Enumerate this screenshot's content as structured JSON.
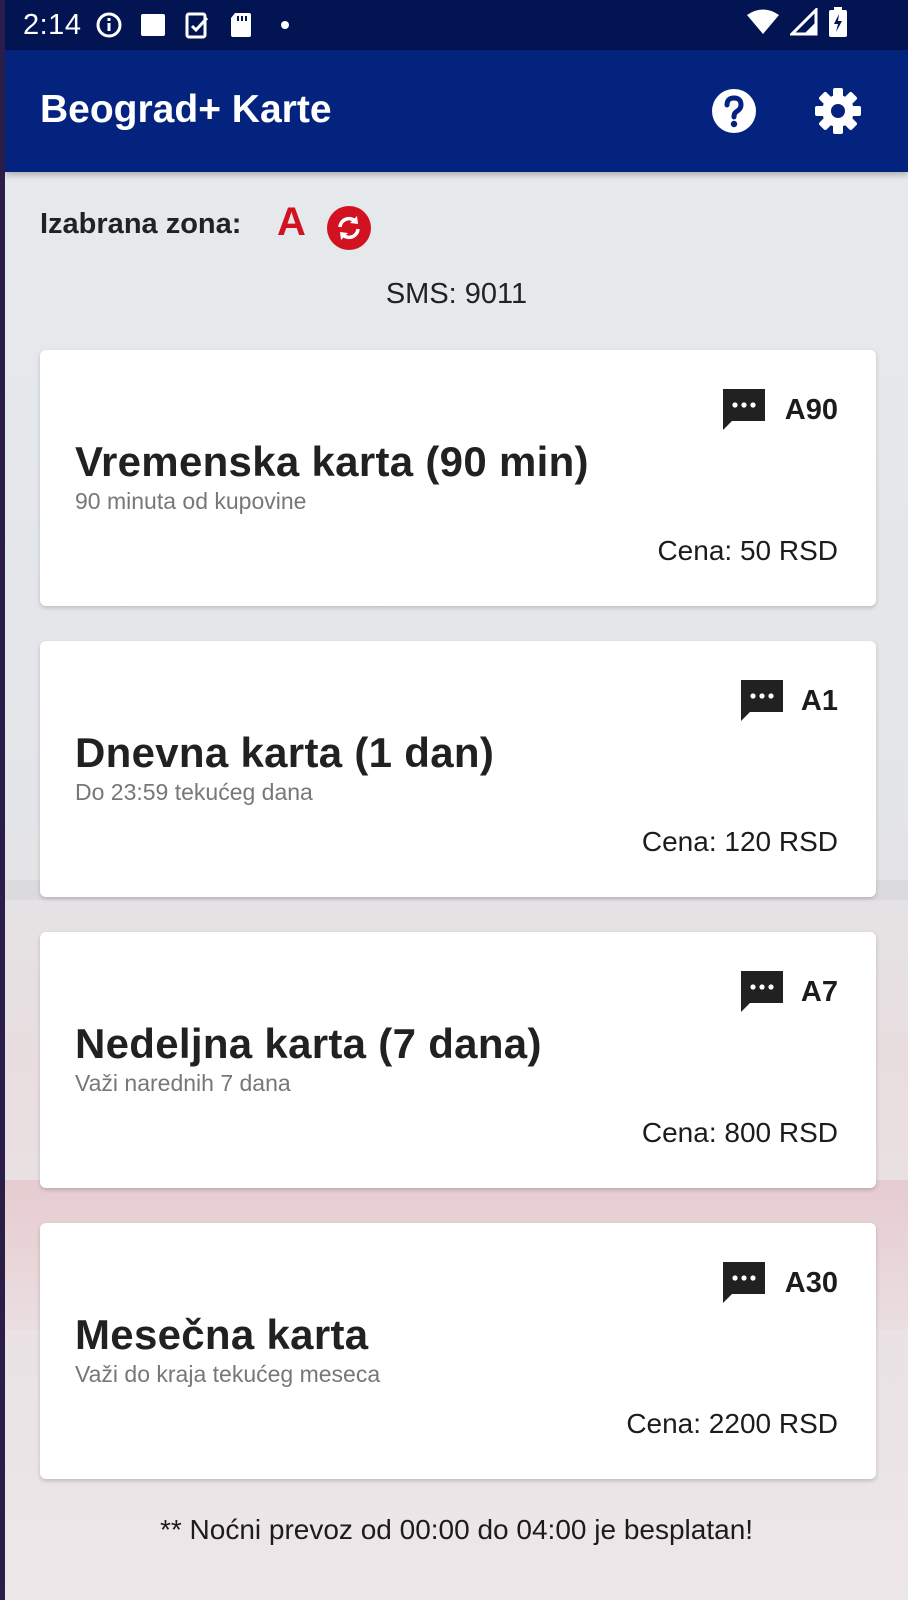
{
  "status_bar": {
    "time": "2:14",
    "left_icons": [
      "info-icon",
      "square-icon",
      "checklist-icon",
      "sd-card-icon",
      "dot-icon"
    ],
    "right_icons": [
      "wifi-icon",
      "signal-icon",
      "battery-charging-icon"
    ]
  },
  "app_bar": {
    "title": "Beograd+ Karte",
    "help_icon": "help-circle-icon",
    "settings_icon": "gear-icon"
  },
  "zone": {
    "label": "Izabrana zona:",
    "value": "A",
    "switch_icon": "sync-icon"
  },
  "sms_number": "SMS: 9011",
  "tickets": [
    {
      "code": "A90",
      "title": "Vremenska karta (90 min)",
      "subtitle": "90 minuta od kupovine",
      "price": "Cena: 50 RSD"
    },
    {
      "code": "A1",
      "title": "Dnevna karta (1 dan)",
      "subtitle": "Do 23:59 tekućeg dana",
      "price": "Cena: 120 RSD"
    },
    {
      "code": "A7",
      "title": "Nedeljna karta (7 dana)",
      "subtitle": "Važi narednih 7 dana",
      "price": "Cena: 800 RSD"
    },
    {
      "code": "A30",
      "title": "Mesečna karta",
      "subtitle": "Važi do kraja tekućeg meseca",
      "price": "Cena: 2200 RSD"
    }
  ],
  "footer_note": "** Noćni prevoz od 00:00 do 04:00 je besplatan!",
  "colors": {
    "status_bar": "#021552",
    "app_bar": "#03237f",
    "zone_accent": "#d21221"
  }
}
